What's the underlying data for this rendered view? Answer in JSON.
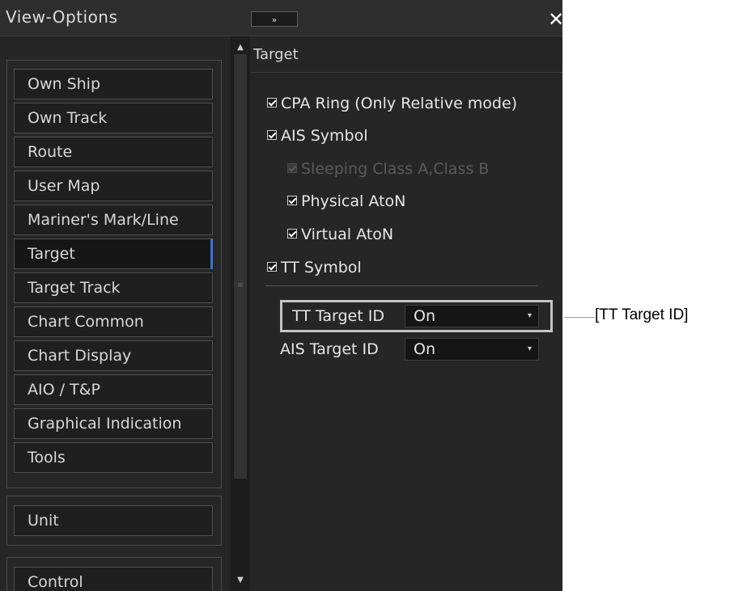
{
  "window": {
    "title": "View-Options",
    "expand_glyph": "»",
    "close_glyph": "✕"
  },
  "nav": {
    "items": [
      {
        "label": "Own Ship",
        "active": false
      },
      {
        "label": "Own Track",
        "active": false
      },
      {
        "label": "Route",
        "active": false
      },
      {
        "label": "User Map",
        "active": false
      },
      {
        "label": "Mariner's Mark/Line",
        "active": false
      },
      {
        "label": "Target",
        "active": true
      },
      {
        "label": "Target Track",
        "active": false
      },
      {
        "label": "Chart Common",
        "active": false
      },
      {
        "label": "Chart Display",
        "active": false
      },
      {
        "label": "AIO / T&P",
        "active": false
      },
      {
        "label": "Graphical Indication",
        "active": false
      },
      {
        "label": "Tools",
        "active": false
      }
    ],
    "unit_label": "Unit",
    "control_label": "Control"
  },
  "scrollbar": {
    "up_glyph": "▲",
    "down_glyph": "▼",
    "grip_glyph": "≡"
  },
  "content": {
    "section_title": "Target",
    "checkboxes": [
      {
        "label": "CPA Ring (Only Relative mode)",
        "checked": true,
        "enabled": true
      },
      {
        "label": "AIS Symbol",
        "checked": true,
        "enabled": true
      },
      {
        "label": "Sleeping Class A,Class B",
        "checked": true,
        "enabled": false
      },
      {
        "label": "Physical AtoN",
        "checked": true,
        "enabled": true
      },
      {
        "label": "Virtual AtoN",
        "checked": true,
        "enabled": true
      },
      {
        "label": "TT Symbol",
        "checked": true,
        "enabled": true
      }
    ],
    "tt_target_id": {
      "label": "TT Target ID",
      "value": "On"
    },
    "ais_target_id": {
      "label": "AIS Target ID",
      "value": "On"
    },
    "dropdown_arrow": "▾"
  },
  "callout": {
    "label": "[TT Target ID]"
  }
}
